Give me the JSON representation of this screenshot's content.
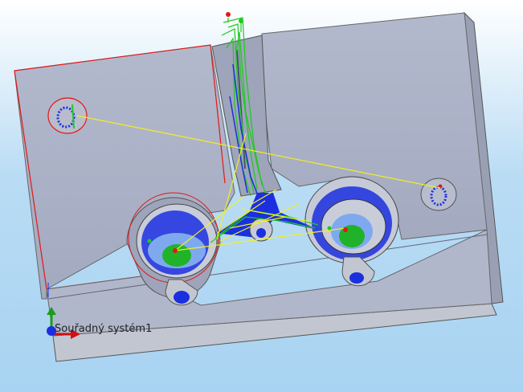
{
  "viewport": {
    "background_top": "#ffffff",
    "background_bottom": "#a8d3f2"
  },
  "model": {
    "part_color": "#aab1c6",
    "toolpath_green": "#1fc91f",
    "toolpath_blue": "#1b2fe0",
    "rapid_yellow": "#f0f020",
    "selection_red": "#e01818"
  },
  "coordinate_system": {
    "label": "Souřadný systém1",
    "axis_icons": [
      "x-axis-arrow-icon",
      "y-axis-arrow-icon",
      "z-axis-arrow-icon"
    ]
  }
}
